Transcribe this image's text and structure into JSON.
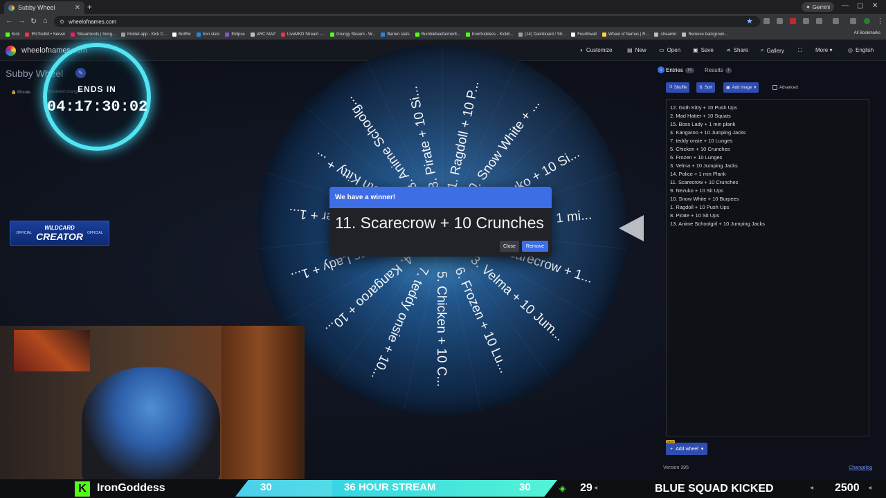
{
  "browser": {
    "tab_title": "Subby Wheel",
    "tab_close": "✕",
    "new_tab": "+",
    "gemini_label": "Gemini",
    "url": "wheelofnames.com",
    "window_controls": [
      "—",
      "▢",
      "✕"
    ],
    "bookmarks": [
      {
        "label": "Kick",
        "color": "#53fc18"
      },
      {
        "label": "IRLToolkit • Server",
        "color": "#e53935"
      },
      {
        "label": "Streamloots | Irong...",
        "color": "#e91e63"
      },
      {
        "label": "Kicklet.app - Kick C...",
        "color": "#9e9e9e"
      },
      {
        "label": "BotRix",
        "color": "#ffffff"
      },
      {
        "label": "Iron stats",
        "color": "#1e88e5"
      },
      {
        "label": "Eklipse",
        "color": "#7e57c2"
      },
      {
        "label": "ARC MAP",
        "color": "#bdbdbd"
      },
      {
        "label": "LiveMKD Stream -...",
        "color": "#e53935"
      },
      {
        "label": "Grungy Stream - W...",
        "color": "#53fc18"
      },
      {
        "label": "Barren stats",
        "color": "#1e88e5"
      },
      {
        "label": "Bumblebeefarmer8...",
        "color": "#53fc18"
      },
      {
        "label": "IronGoddess - Kick8...",
        "color": "#53fc18"
      },
      {
        "label": "(14) Dashboard / Str...",
        "color": "#9e9e9e"
      },
      {
        "label": "Fourthwall",
        "color": "#ffffff"
      },
      {
        "label": "Wheel of Names | R...",
        "color": "#fdd835"
      },
      {
        "label": "streamin",
        "color": "#bdbdbd"
      },
      {
        "label": "Remove backgroun...",
        "color": "#bdbdbd"
      }
    ],
    "all_bookmarks": "All Bookmarks"
  },
  "app": {
    "brand": "wheelofnames.com",
    "menu": [
      {
        "icon": "palette-icon",
        "glyph": "◐",
        "label": "Customize"
      },
      {
        "icon": "new-icon",
        "glyph": "▤",
        "label": "New"
      },
      {
        "icon": "open-icon",
        "glyph": "▭",
        "label": "Open"
      },
      {
        "icon": "save-icon",
        "glyph": "▣",
        "label": "Save"
      },
      {
        "icon": "share-icon",
        "glyph": "⋖",
        "label": "Share"
      },
      {
        "icon": "gallery-icon",
        "glyph": "⌕",
        "label": "Gallery"
      },
      {
        "icon": "fullscreen-icon",
        "glyph": "⛶",
        "label": ""
      },
      {
        "icon": "more-icon",
        "glyph": "",
        "label": "More ▾"
      },
      {
        "icon": "language-icon",
        "glyph": "◎",
        "label": "English"
      }
    ],
    "wheel_title": "Subby Wheel",
    "visibility": "Private",
    "save_status": "Unsaved changes"
  },
  "overlay": {
    "timer_label": "ENDS IN",
    "timer_value": "04:17:30:02",
    "badge_top": "WILDCARD",
    "badge_bottom": "CREATOR",
    "badge_side": "OFFICIAL"
  },
  "wheel": {
    "labels": [
      "1. Ragdoll + 10 P...",
      "10. Snow White + ...",
      "9. Nezuko + 10 Si...",
      "14. Police + 1 mi...",
      "11. Scarecrow + 1...",
      "3. Velma + 10 Jum...",
      "6. Frozen + 10 Lu...",
      "5. Chicken + 10 C...",
      "7. teddy onsie + 10...",
      "4. Kangaroo + 10...",
      "15. Boss Lady + 1...",
      "2. Mad Hatter + 1...",
      "12. Goth Kitty + ...",
      "13. Anime Schoolg...",
      "8. Pirate + 10 Si..."
    ],
    "accent": "#3d6ee6"
  },
  "dialog": {
    "title": "We have a winner!",
    "winner": "11. Scarecrow + 10 Crunches",
    "close_label": "Close",
    "remove_label": "Remove"
  },
  "panel": {
    "entries_tab": "Entries",
    "entries_count": "15",
    "results_tab": "Results",
    "results_count": "1",
    "shuffle_label": "Shuffle",
    "sort_label": "Sort",
    "add_image_label": "Add image",
    "advanced_label": "Advanced",
    "entries": [
      "12. Goth Kitty + 10 Push Ups",
      "2. Mad Hatter + 10 Squats",
      "15. Boss Lady + 1 min plank",
      "4. Kangaroo + 10 Jumping Jacks",
      "7. teddy onsie + 10 Lunges",
      "5. Chicken + 10 Crunches",
      "6. Frozen + 10 Lunges",
      "3. Velma + 10 Jumping Jacks",
      "14. Police + 1 min Plank",
      "11. Scarecrow + 10 Crunches",
      "9. Nezuko + 10 Sit Ups",
      "10. Snow White + 10 Burpees",
      "1. Ragdoll + 10 Push Ups",
      "8. Pirate + 10 Sit Ups",
      "13. Anime Schoolgirl + 10 Jumping Jacks"
    ],
    "new_badge": "NEW",
    "add_wheel_label": "Add wheel",
    "version": "Version 395",
    "changelog": "Changelog"
  },
  "ticker": {
    "streamer": "IronGoddess",
    "bar_left": "30",
    "bar_title": "36 HOUR STREAM",
    "bar_right": "30",
    "bar_progress": 0.3,
    "count_a": "29",
    "message": "BLUE SQUAD KICKED",
    "count_b": "2500"
  }
}
